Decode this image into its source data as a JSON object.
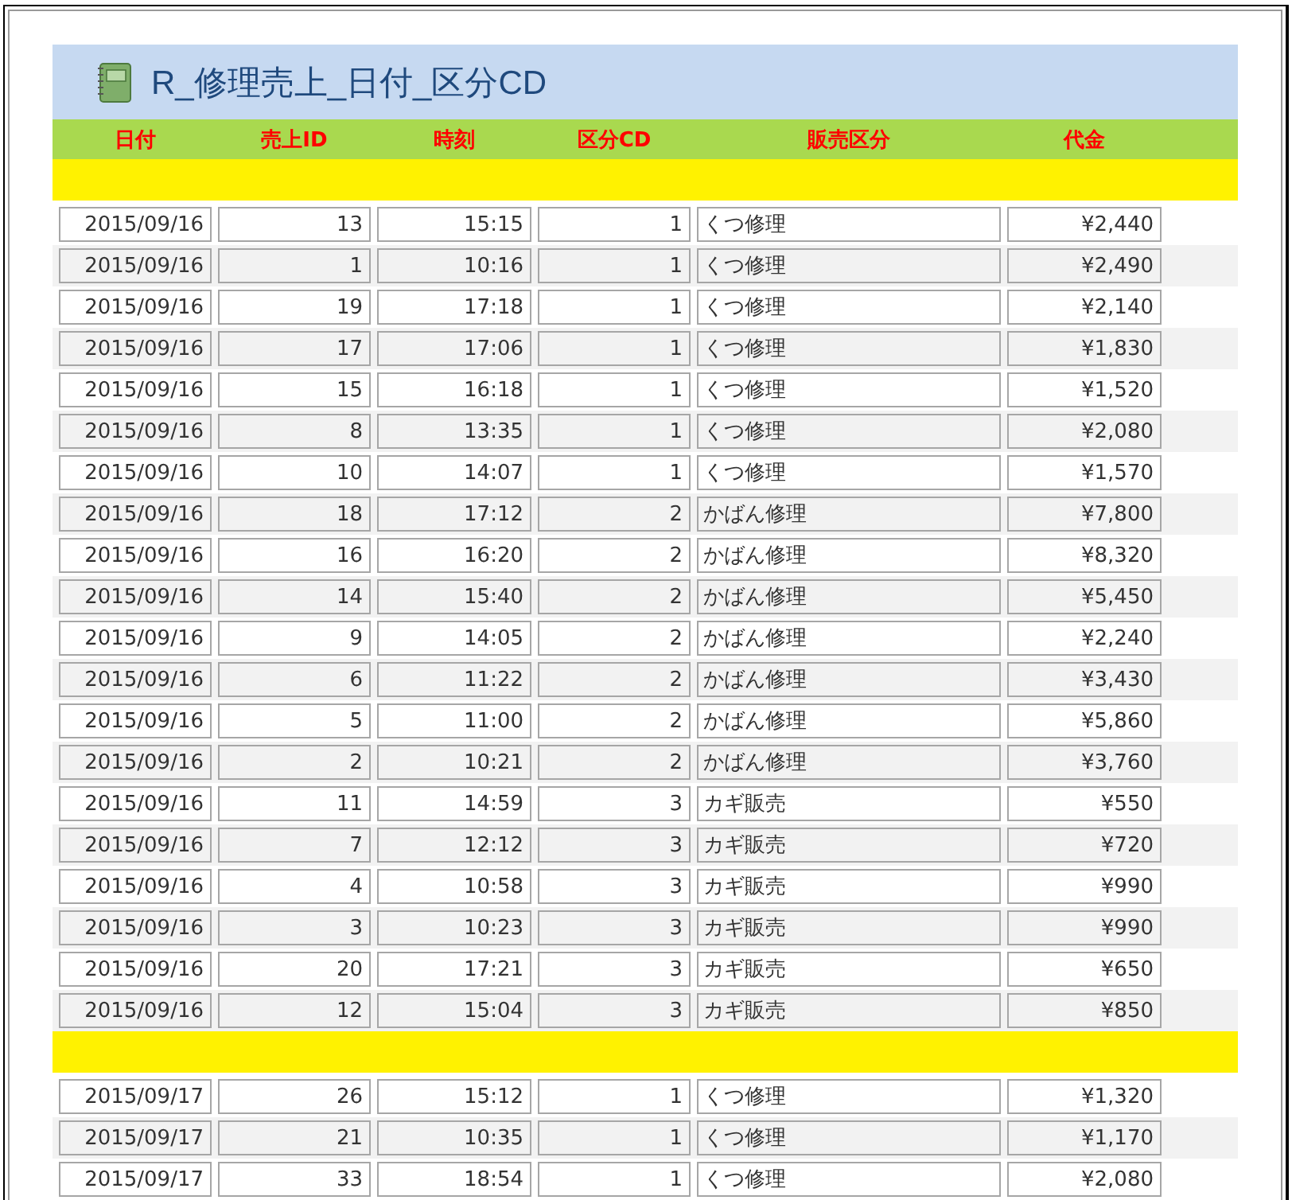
{
  "report": {
    "title": "R_修理売上_日付_区分CD"
  },
  "columns": [
    "日付",
    "売上ID",
    "時刻",
    "区分CD",
    "販売区分",
    "代金"
  ],
  "groups": [
    {
      "rows": [
        [
          "2015/09/16",
          "13",
          "15:15",
          "1",
          "くつ修理",
          "¥2,440"
        ],
        [
          "2015/09/16",
          "1",
          "10:16",
          "1",
          "くつ修理",
          "¥2,490"
        ],
        [
          "2015/09/16",
          "19",
          "17:18",
          "1",
          "くつ修理",
          "¥2,140"
        ],
        [
          "2015/09/16",
          "17",
          "17:06",
          "1",
          "くつ修理",
          "¥1,830"
        ],
        [
          "2015/09/16",
          "15",
          "16:18",
          "1",
          "くつ修理",
          "¥1,520"
        ],
        [
          "2015/09/16",
          "8",
          "13:35",
          "1",
          "くつ修理",
          "¥2,080"
        ],
        [
          "2015/09/16",
          "10",
          "14:07",
          "1",
          "くつ修理",
          "¥1,570"
        ],
        [
          "2015/09/16",
          "18",
          "17:12",
          "2",
          "かばん修理",
          "¥7,800"
        ],
        [
          "2015/09/16",
          "16",
          "16:20",
          "2",
          "かばん修理",
          "¥8,320"
        ],
        [
          "2015/09/16",
          "14",
          "15:40",
          "2",
          "かばん修理",
          "¥5,450"
        ],
        [
          "2015/09/16",
          "9",
          "14:05",
          "2",
          "かばん修理",
          "¥2,240"
        ],
        [
          "2015/09/16",
          "6",
          "11:22",
          "2",
          "かばん修理",
          "¥3,430"
        ],
        [
          "2015/09/16",
          "5",
          "11:00",
          "2",
          "かばん修理",
          "¥5,860"
        ],
        [
          "2015/09/16",
          "2",
          "10:21",
          "2",
          "かばん修理",
          "¥3,760"
        ],
        [
          "2015/09/16",
          "11",
          "14:59",
          "3",
          "カギ販売",
          "¥550"
        ],
        [
          "2015/09/16",
          "7",
          "12:12",
          "3",
          "カギ販売",
          "¥720"
        ],
        [
          "2015/09/16",
          "4",
          "10:58",
          "3",
          "カギ販売",
          "¥990"
        ],
        [
          "2015/09/16",
          "3",
          "10:23",
          "3",
          "カギ販売",
          "¥990"
        ],
        [
          "2015/09/16",
          "20",
          "17:21",
          "3",
          "カギ販売",
          "¥650"
        ],
        [
          "2015/09/16",
          "12",
          "15:04",
          "3",
          "カギ販売",
          "¥850"
        ]
      ]
    },
    {
      "rows": [
        [
          "2015/09/17",
          "26",
          "15:12",
          "1",
          "くつ修理",
          "¥1,320"
        ],
        [
          "2015/09/17",
          "21",
          "10:35",
          "1",
          "くつ修理",
          "¥1,170"
        ],
        [
          "2015/09/17",
          "33",
          "18:54",
          "1",
          "くつ修理",
          "¥2,080"
        ]
      ]
    }
  ]
}
